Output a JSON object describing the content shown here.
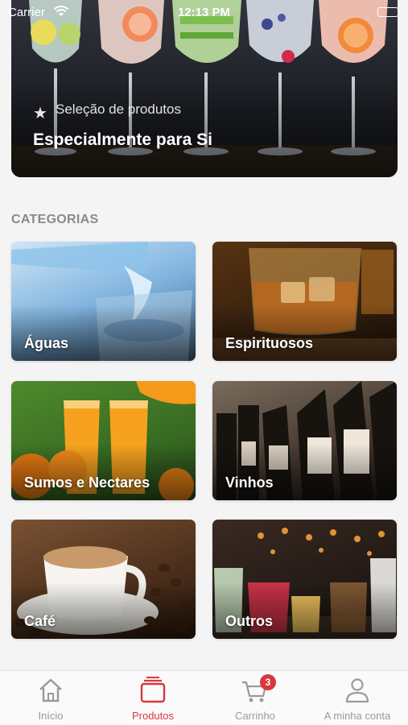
{
  "status_bar": {
    "carrier": "Carrier",
    "time": "12:13 PM"
  },
  "hero": {
    "subtitle": "Seleção de produtos",
    "title": "Especialmente para Si"
  },
  "categories": {
    "heading": "CATEGORIAS",
    "items": [
      {
        "label": "Águas"
      },
      {
        "label": "Espirituosos"
      },
      {
        "label": "Sumos e Nectares"
      },
      {
        "label": "Vinhos"
      },
      {
        "label": "Café"
      },
      {
        "label": "Outros"
      }
    ]
  },
  "tab_bar": {
    "tabs": [
      {
        "label": "Início",
        "icon": "home-icon"
      },
      {
        "label": "Produtos",
        "icon": "products-icon",
        "active": true
      },
      {
        "label": "Carrinho",
        "icon": "cart-icon",
        "badge": "3"
      },
      {
        "label": "A minha conta",
        "icon": "user-icon"
      }
    ]
  },
  "colors": {
    "accent": "#d9363e",
    "inactive": "#9a9a9a",
    "section_label": "#8a8a8a"
  }
}
